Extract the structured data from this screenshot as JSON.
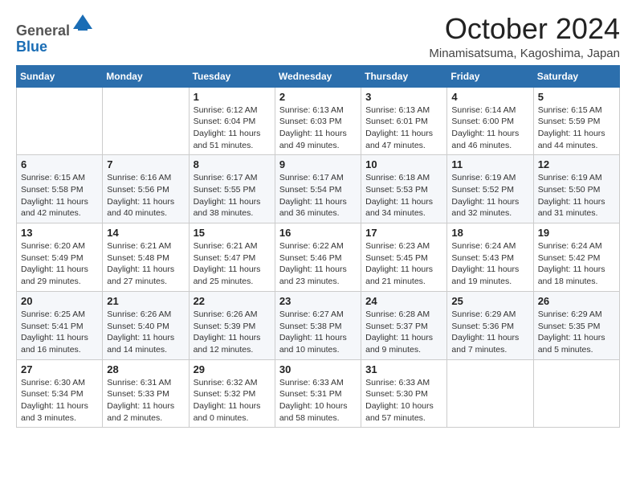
{
  "logo": {
    "general": "General",
    "blue": "Blue"
  },
  "header": {
    "month": "October 2024",
    "location": "Minamisatsuma, Kagoshima, Japan"
  },
  "days_of_week": [
    "Sunday",
    "Monday",
    "Tuesday",
    "Wednesday",
    "Thursday",
    "Friday",
    "Saturday"
  ],
  "weeks": [
    [
      {
        "day": "",
        "sunrise": "",
        "sunset": "",
        "daylight": ""
      },
      {
        "day": "",
        "sunrise": "",
        "sunset": "",
        "daylight": ""
      },
      {
        "day": "1",
        "sunrise": "Sunrise: 6:12 AM",
        "sunset": "Sunset: 6:04 PM",
        "daylight": "Daylight: 11 hours and 51 minutes."
      },
      {
        "day": "2",
        "sunrise": "Sunrise: 6:13 AM",
        "sunset": "Sunset: 6:03 PM",
        "daylight": "Daylight: 11 hours and 49 minutes."
      },
      {
        "day": "3",
        "sunrise": "Sunrise: 6:13 AM",
        "sunset": "Sunset: 6:01 PM",
        "daylight": "Daylight: 11 hours and 47 minutes."
      },
      {
        "day": "4",
        "sunrise": "Sunrise: 6:14 AM",
        "sunset": "Sunset: 6:00 PM",
        "daylight": "Daylight: 11 hours and 46 minutes."
      },
      {
        "day": "5",
        "sunrise": "Sunrise: 6:15 AM",
        "sunset": "Sunset: 5:59 PM",
        "daylight": "Daylight: 11 hours and 44 minutes."
      }
    ],
    [
      {
        "day": "6",
        "sunrise": "Sunrise: 6:15 AM",
        "sunset": "Sunset: 5:58 PM",
        "daylight": "Daylight: 11 hours and 42 minutes."
      },
      {
        "day": "7",
        "sunrise": "Sunrise: 6:16 AM",
        "sunset": "Sunset: 5:56 PM",
        "daylight": "Daylight: 11 hours and 40 minutes."
      },
      {
        "day": "8",
        "sunrise": "Sunrise: 6:17 AM",
        "sunset": "Sunset: 5:55 PM",
        "daylight": "Daylight: 11 hours and 38 minutes."
      },
      {
        "day": "9",
        "sunrise": "Sunrise: 6:17 AM",
        "sunset": "Sunset: 5:54 PM",
        "daylight": "Daylight: 11 hours and 36 minutes."
      },
      {
        "day": "10",
        "sunrise": "Sunrise: 6:18 AM",
        "sunset": "Sunset: 5:53 PM",
        "daylight": "Daylight: 11 hours and 34 minutes."
      },
      {
        "day": "11",
        "sunrise": "Sunrise: 6:19 AM",
        "sunset": "Sunset: 5:52 PM",
        "daylight": "Daylight: 11 hours and 32 minutes."
      },
      {
        "day": "12",
        "sunrise": "Sunrise: 6:19 AM",
        "sunset": "Sunset: 5:50 PM",
        "daylight": "Daylight: 11 hours and 31 minutes."
      }
    ],
    [
      {
        "day": "13",
        "sunrise": "Sunrise: 6:20 AM",
        "sunset": "Sunset: 5:49 PM",
        "daylight": "Daylight: 11 hours and 29 minutes."
      },
      {
        "day": "14",
        "sunrise": "Sunrise: 6:21 AM",
        "sunset": "Sunset: 5:48 PM",
        "daylight": "Daylight: 11 hours and 27 minutes."
      },
      {
        "day": "15",
        "sunrise": "Sunrise: 6:21 AM",
        "sunset": "Sunset: 5:47 PM",
        "daylight": "Daylight: 11 hours and 25 minutes."
      },
      {
        "day": "16",
        "sunrise": "Sunrise: 6:22 AM",
        "sunset": "Sunset: 5:46 PM",
        "daylight": "Daylight: 11 hours and 23 minutes."
      },
      {
        "day": "17",
        "sunrise": "Sunrise: 6:23 AM",
        "sunset": "Sunset: 5:45 PM",
        "daylight": "Daylight: 11 hours and 21 minutes."
      },
      {
        "day": "18",
        "sunrise": "Sunrise: 6:24 AM",
        "sunset": "Sunset: 5:43 PM",
        "daylight": "Daylight: 11 hours and 19 minutes."
      },
      {
        "day": "19",
        "sunrise": "Sunrise: 6:24 AM",
        "sunset": "Sunset: 5:42 PM",
        "daylight": "Daylight: 11 hours and 18 minutes."
      }
    ],
    [
      {
        "day": "20",
        "sunrise": "Sunrise: 6:25 AM",
        "sunset": "Sunset: 5:41 PM",
        "daylight": "Daylight: 11 hours and 16 minutes."
      },
      {
        "day": "21",
        "sunrise": "Sunrise: 6:26 AM",
        "sunset": "Sunset: 5:40 PM",
        "daylight": "Daylight: 11 hours and 14 minutes."
      },
      {
        "day": "22",
        "sunrise": "Sunrise: 6:26 AM",
        "sunset": "Sunset: 5:39 PM",
        "daylight": "Daylight: 11 hours and 12 minutes."
      },
      {
        "day": "23",
        "sunrise": "Sunrise: 6:27 AM",
        "sunset": "Sunset: 5:38 PM",
        "daylight": "Daylight: 11 hours and 10 minutes."
      },
      {
        "day": "24",
        "sunrise": "Sunrise: 6:28 AM",
        "sunset": "Sunset: 5:37 PM",
        "daylight": "Daylight: 11 hours and 9 minutes."
      },
      {
        "day": "25",
        "sunrise": "Sunrise: 6:29 AM",
        "sunset": "Sunset: 5:36 PM",
        "daylight": "Daylight: 11 hours and 7 minutes."
      },
      {
        "day": "26",
        "sunrise": "Sunrise: 6:29 AM",
        "sunset": "Sunset: 5:35 PM",
        "daylight": "Daylight: 11 hours and 5 minutes."
      }
    ],
    [
      {
        "day": "27",
        "sunrise": "Sunrise: 6:30 AM",
        "sunset": "Sunset: 5:34 PM",
        "daylight": "Daylight: 11 hours and 3 minutes."
      },
      {
        "day": "28",
        "sunrise": "Sunrise: 6:31 AM",
        "sunset": "Sunset: 5:33 PM",
        "daylight": "Daylight: 11 hours and 2 minutes."
      },
      {
        "day": "29",
        "sunrise": "Sunrise: 6:32 AM",
        "sunset": "Sunset: 5:32 PM",
        "daylight": "Daylight: 11 hours and 0 minutes."
      },
      {
        "day": "30",
        "sunrise": "Sunrise: 6:33 AM",
        "sunset": "Sunset: 5:31 PM",
        "daylight": "Daylight: 10 hours and 58 minutes."
      },
      {
        "day": "31",
        "sunrise": "Sunrise: 6:33 AM",
        "sunset": "Sunset: 5:30 PM",
        "daylight": "Daylight: 10 hours and 57 minutes."
      },
      {
        "day": "",
        "sunrise": "",
        "sunset": "",
        "daylight": ""
      },
      {
        "day": "",
        "sunrise": "",
        "sunset": "",
        "daylight": ""
      }
    ]
  ]
}
